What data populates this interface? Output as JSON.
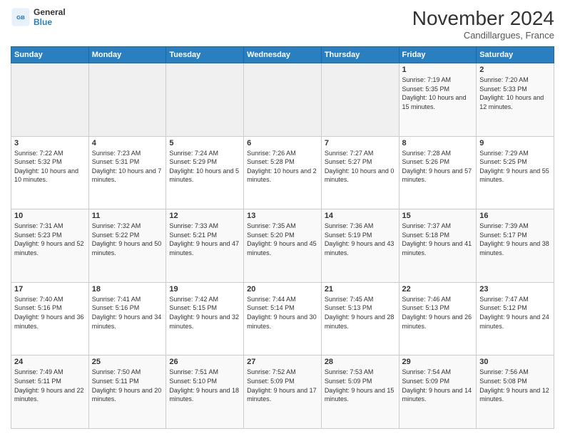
{
  "logo": {
    "line1": "General",
    "line2": "Blue"
  },
  "header": {
    "month": "November 2024",
    "location": "Candillargues, France"
  },
  "weekdays": [
    "Sunday",
    "Monday",
    "Tuesday",
    "Wednesday",
    "Thursday",
    "Friday",
    "Saturday"
  ],
  "weeks": [
    [
      {
        "day": "",
        "sunrise": "",
        "sunset": "",
        "daylight": ""
      },
      {
        "day": "",
        "sunrise": "",
        "sunset": "",
        "daylight": ""
      },
      {
        "day": "",
        "sunrise": "",
        "sunset": "",
        "daylight": ""
      },
      {
        "day": "",
        "sunrise": "",
        "sunset": "",
        "daylight": ""
      },
      {
        "day": "",
        "sunrise": "",
        "sunset": "",
        "daylight": ""
      },
      {
        "day": "1",
        "sunrise": "Sunrise: 7:19 AM",
        "sunset": "Sunset: 5:35 PM",
        "daylight": "Daylight: 10 hours and 15 minutes."
      },
      {
        "day": "2",
        "sunrise": "Sunrise: 7:20 AM",
        "sunset": "Sunset: 5:33 PM",
        "daylight": "Daylight: 10 hours and 12 minutes."
      }
    ],
    [
      {
        "day": "3",
        "sunrise": "Sunrise: 7:22 AM",
        "sunset": "Sunset: 5:32 PM",
        "daylight": "Daylight: 10 hours and 10 minutes."
      },
      {
        "day": "4",
        "sunrise": "Sunrise: 7:23 AM",
        "sunset": "Sunset: 5:31 PM",
        "daylight": "Daylight: 10 hours and 7 minutes."
      },
      {
        "day": "5",
        "sunrise": "Sunrise: 7:24 AM",
        "sunset": "Sunset: 5:29 PM",
        "daylight": "Daylight: 10 hours and 5 minutes."
      },
      {
        "day": "6",
        "sunrise": "Sunrise: 7:26 AM",
        "sunset": "Sunset: 5:28 PM",
        "daylight": "Daylight: 10 hours and 2 minutes."
      },
      {
        "day": "7",
        "sunrise": "Sunrise: 7:27 AM",
        "sunset": "Sunset: 5:27 PM",
        "daylight": "Daylight: 10 hours and 0 minutes."
      },
      {
        "day": "8",
        "sunrise": "Sunrise: 7:28 AM",
        "sunset": "Sunset: 5:26 PM",
        "daylight": "Daylight: 9 hours and 57 minutes."
      },
      {
        "day": "9",
        "sunrise": "Sunrise: 7:29 AM",
        "sunset": "Sunset: 5:25 PM",
        "daylight": "Daylight: 9 hours and 55 minutes."
      }
    ],
    [
      {
        "day": "10",
        "sunrise": "Sunrise: 7:31 AM",
        "sunset": "Sunset: 5:23 PM",
        "daylight": "Daylight: 9 hours and 52 minutes."
      },
      {
        "day": "11",
        "sunrise": "Sunrise: 7:32 AM",
        "sunset": "Sunset: 5:22 PM",
        "daylight": "Daylight: 9 hours and 50 minutes."
      },
      {
        "day": "12",
        "sunrise": "Sunrise: 7:33 AM",
        "sunset": "Sunset: 5:21 PM",
        "daylight": "Daylight: 9 hours and 47 minutes."
      },
      {
        "day": "13",
        "sunrise": "Sunrise: 7:35 AM",
        "sunset": "Sunset: 5:20 PM",
        "daylight": "Daylight: 9 hours and 45 minutes."
      },
      {
        "day": "14",
        "sunrise": "Sunrise: 7:36 AM",
        "sunset": "Sunset: 5:19 PM",
        "daylight": "Daylight: 9 hours and 43 minutes."
      },
      {
        "day": "15",
        "sunrise": "Sunrise: 7:37 AM",
        "sunset": "Sunset: 5:18 PM",
        "daylight": "Daylight: 9 hours and 41 minutes."
      },
      {
        "day": "16",
        "sunrise": "Sunrise: 7:39 AM",
        "sunset": "Sunset: 5:17 PM",
        "daylight": "Daylight: 9 hours and 38 minutes."
      }
    ],
    [
      {
        "day": "17",
        "sunrise": "Sunrise: 7:40 AM",
        "sunset": "Sunset: 5:16 PM",
        "daylight": "Daylight: 9 hours and 36 minutes."
      },
      {
        "day": "18",
        "sunrise": "Sunrise: 7:41 AM",
        "sunset": "Sunset: 5:16 PM",
        "daylight": "Daylight: 9 hours and 34 minutes."
      },
      {
        "day": "19",
        "sunrise": "Sunrise: 7:42 AM",
        "sunset": "Sunset: 5:15 PM",
        "daylight": "Daylight: 9 hours and 32 minutes."
      },
      {
        "day": "20",
        "sunrise": "Sunrise: 7:44 AM",
        "sunset": "Sunset: 5:14 PM",
        "daylight": "Daylight: 9 hours and 30 minutes."
      },
      {
        "day": "21",
        "sunrise": "Sunrise: 7:45 AM",
        "sunset": "Sunset: 5:13 PM",
        "daylight": "Daylight: 9 hours and 28 minutes."
      },
      {
        "day": "22",
        "sunrise": "Sunrise: 7:46 AM",
        "sunset": "Sunset: 5:13 PM",
        "daylight": "Daylight: 9 hours and 26 minutes."
      },
      {
        "day": "23",
        "sunrise": "Sunrise: 7:47 AM",
        "sunset": "Sunset: 5:12 PM",
        "daylight": "Daylight: 9 hours and 24 minutes."
      }
    ],
    [
      {
        "day": "24",
        "sunrise": "Sunrise: 7:49 AM",
        "sunset": "Sunset: 5:11 PM",
        "daylight": "Daylight: 9 hours and 22 minutes."
      },
      {
        "day": "25",
        "sunrise": "Sunrise: 7:50 AM",
        "sunset": "Sunset: 5:11 PM",
        "daylight": "Daylight: 9 hours and 20 minutes."
      },
      {
        "day": "26",
        "sunrise": "Sunrise: 7:51 AM",
        "sunset": "Sunset: 5:10 PM",
        "daylight": "Daylight: 9 hours and 18 minutes."
      },
      {
        "day": "27",
        "sunrise": "Sunrise: 7:52 AM",
        "sunset": "Sunset: 5:09 PM",
        "daylight": "Daylight: 9 hours and 17 minutes."
      },
      {
        "day": "28",
        "sunrise": "Sunrise: 7:53 AM",
        "sunset": "Sunset: 5:09 PM",
        "daylight": "Daylight: 9 hours and 15 minutes."
      },
      {
        "day": "29",
        "sunrise": "Sunrise: 7:54 AM",
        "sunset": "Sunset: 5:09 PM",
        "daylight": "Daylight: 9 hours and 14 minutes."
      },
      {
        "day": "30",
        "sunrise": "Sunrise: 7:56 AM",
        "sunset": "Sunset: 5:08 PM",
        "daylight": "Daylight: 9 hours and 12 minutes."
      }
    ]
  ]
}
